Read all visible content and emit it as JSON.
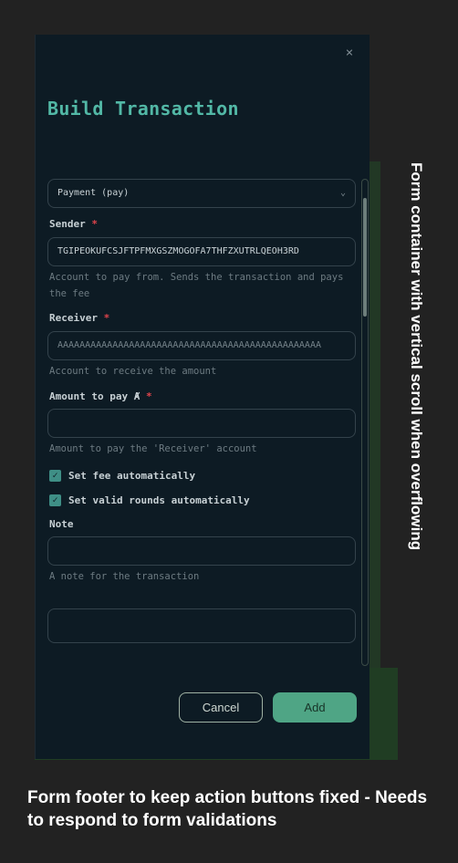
{
  "dialog": {
    "title": "Build Transaction",
    "close_label": "×"
  },
  "form": {
    "type_select": {
      "value": "Payment (pay)",
      "icon": "chevron-down-icon"
    },
    "sender": {
      "label": "Sender",
      "required_mark": "*",
      "value": "TGIPEOKUFCSJFTPFMXGSZMOGOFA7THFZXUTRLQEOH3RD",
      "help": "Account to pay from. Sends the transaction and pays the fee"
    },
    "receiver": {
      "label": "Receiver",
      "required_mark": "*",
      "placeholder": "AAAAAAAAAAAAAAAAAAAAAAAAAAAAAAAAAAAAAAAAAAAAAAAA",
      "help": "Account to receive the amount"
    },
    "amount": {
      "label": "Amount to pay",
      "unit_symbol": "Ⱥ",
      "required_mark": "*",
      "value": "",
      "help": "Amount to pay the 'Receiver' account"
    },
    "checkboxes": [
      {
        "label": "Set fee automatically",
        "checked": true
      },
      {
        "label": "Set valid rounds automatically",
        "checked": true
      }
    ],
    "note": {
      "label": "Note",
      "value": "",
      "help": "A note for the transaction"
    },
    "extra_field": {
      "value": ""
    }
  },
  "footer": {
    "cancel_label": "Cancel",
    "add_label": "Add"
  },
  "annotations": {
    "scroll_note": "Form container  with vertical scroll when overflowing",
    "footer_note": "Form footer to  keep action buttons fixed - Needs to respond to form validations"
  },
  "colors": {
    "background": "#222222",
    "dialog": "#0d1b24",
    "accent": "#52b8a6",
    "required": "#e0444c",
    "annotation_green": "#233a26",
    "add_button": "#4fa585"
  }
}
